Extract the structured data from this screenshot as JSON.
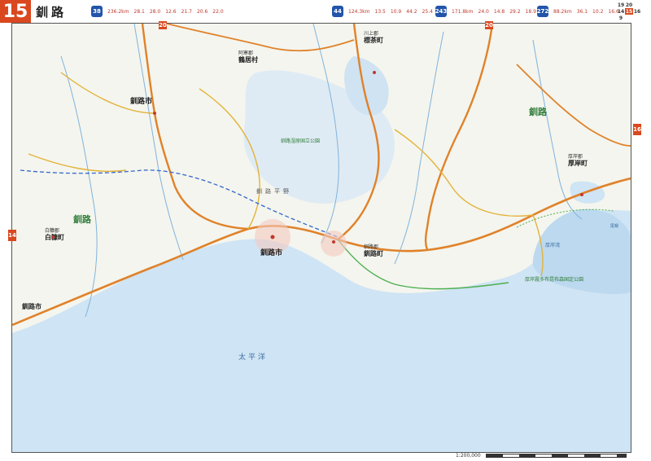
{
  "header": {
    "page_number": "15",
    "title": "釧路",
    "routes": [
      {
        "shield": "38",
        "total": "236.2km",
        "segments": [
          "28.1",
          "28.0",
          "12.6",
          "21.7",
          "20.6",
          "22.0"
        ]
      },
      {
        "shield": "44",
        "total": "124.3km",
        "segments": [
          "13.5",
          "10.9",
          "44.2",
          "25.4"
        ]
      },
      {
        "shield": "243",
        "total": "171.8km",
        "segments": [
          "24.0",
          "14.8",
          "29.2",
          "18.9"
        ]
      },
      {
        "shield": "272",
        "total": "88.2km",
        "segments": [
          "36.1",
          "10.2",
          "16.6"
        ]
      }
    ],
    "index_grid": [
      "19",
      "20",
      "",
      "14",
      "15",
      "16",
      "9",
      "",
      ""
    ],
    "current_page": "15"
  },
  "side_tabs": {
    "left": "14",
    "right": "16",
    "top_a": "20",
    "top_b": "20"
  },
  "labels": {
    "kushiro_city_north": "釧路市",
    "tsurui_village": "鶴居村",
    "tsurui_district": "阿寒郡",
    "shibecha_town": "標茶町",
    "shibecha_district": "川上郡",
    "kushiro_region_west": "釧路",
    "kushiro_region_east": "釧路",
    "akkeshi_town": "厚岸町",
    "akkeshi_district": "厚岸郡",
    "kushiro_city_main": "釧路市",
    "kushiro_town": "釧路町",
    "kushiro_district": "釧路郡",
    "shiranuka_town": "白糠町",
    "shiranuka_district": "白糠郡",
    "kushiro_city_sw": "釧路市",
    "pacific_ocean": "太平洋",
    "kushiro_plain": "釧路平野",
    "kushiro_marsh_park": "釧路湿原国立公園",
    "akkeshi_park": "厚岸霧多布昆布森国定公園",
    "akkeshi_bay": "厚岸湾",
    "hokkai_bay": "尾幌"
  },
  "scale": {
    "text": "1:200,000"
  }
}
